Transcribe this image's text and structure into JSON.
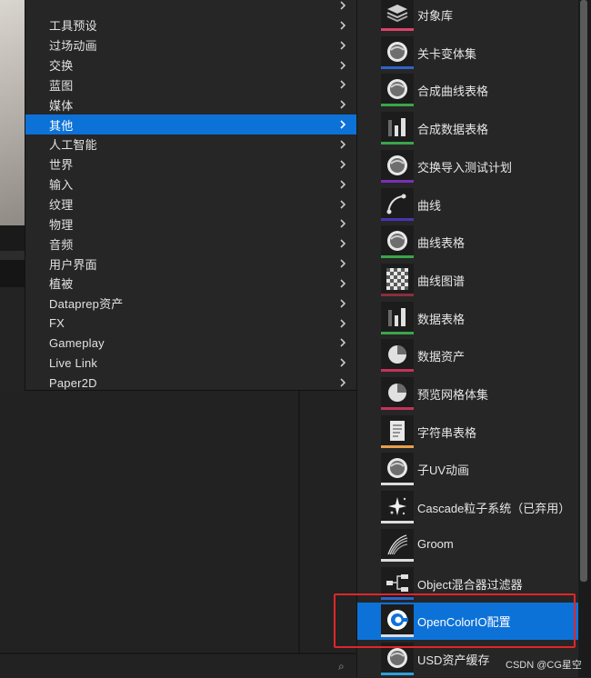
{
  "left_menu": {
    "items": [
      {
        "label": "",
        "icon": "chevron-right-icon"
      },
      {
        "label": "工具预设",
        "icon": "chevron-right-icon"
      },
      {
        "label": "过场动画",
        "icon": "chevron-right-icon"
      },
      {
        "label": "交换",
        "icon": "chevron-right-icon"
      },
      {
        "label": "蓝图",
        "icon": "chevron-right-icon"
      },
      {
        "label": "媒体",
        "icon": "chevron-right-icon"
      },
      {
        "label": "其他",
        "icon": "chevron-right-icon",
        "active": true
      },
      {
        "label": "人工智能",
        "icon": "chevron-right-icon"
      },
      {
        "label": "世界",
        "icon": "chevron-right-icon"
      },
      {
        "label": "输入",
        "icon": "chevron-right-icon"
      },
      {
        "label": "纹理",
        "icon": "chevron-right-icon"
      },
      {
        "label": "物理",
        "icon": "chevron-right-icon"
      },
      {
        "label": "音频",
        "icon": "chevron-right-icon"
      },
      {
        "label": "用户界面",
        "icon": "chevron-right-icon"
      },
      {
        "label": "植被",
        "icon": "chevron-right-icon"
      },
      {
        "label": "Dataprep资产",
        "icon": "chevron-right-icon"
      },
      {
        "label": "FX",
        "icon": "chevron-right-icon"
      },
      {
        "label": "Gameplay",
        "icon": "chevron-right-icon"
      },
      {
        "label": "Live Link",
        "icon": "chevron-right-icon"
      },
      {
        "label": "Paper2D",
        "icon": "chevron-right-icon"
      }
    ]
  },
  "submenu": {
    "items": [
      {
        "label": "对象库",
        "icon": "object-library-icon",
        "bar_color": "#d9426a"
      },
      {
        "label": "关卡变体集",
        "icon": "sphere-icon",
        "bar_color": "#2f64c8"
      },
      {
        "label": "合成曲线表格",
        "icon": "sphere-icon",
        "bar_color": "#3aa64a"
      },
      {
        "label": "合成数据表格",
        "icon": "bar-chart-icon",
        "bar_color": "#3aa64a"
      },
      {
        "label": "交换导入测试计划",
        "icon": "sphere-icon",
        "bar_color": "#7a2fb8"
      },
      {
        "label": "曲线",
        "icon": "curve-icon",
        "bar_color": "#4b34b0"
      },
      {
        "label": "曲线表格",
        "icon": "sphere-icon",
        "bar_color": "#3aa64a"
      },
      {
        "label": "曲线图谱",
        "icon": "checker-icon",
        "bar_color": "#8a2e3e"
      },
      {
        "label": "数据表格",
        "icon": "bar-chart-icon",
        "bar_color": "#3aa64a"
      },
      {
        "label": "数据资产",
        "icon": "pie-chart-icon",
        "bar_color": "#c2335a"
      },
      {
        "label": "预览网格体集",
        "icon": "pie-chart-icon",
        "bar_color": "#c2335a"
      },
      {
        "label": "字符串表格",
        "icon": "string-table-icon",
        "bar_color": "#e8a04a"
      },
      {
        "label": "子UV动画",
        "icon": "sphere-icon",
        "bar_color": "#dcdcdc"
      },
      {
        "label": "Cascade粒子系统（已弃用）",
        "icon": "sparkle-icon",
        "bar_color": "#dcdcdc"
      },
      {
        "label": "Groom",
        "icon": "groom-icon",
        "bar_color": "#dcdcdc"
      },
      {
        "label": "Object混合器过滤器",
        "icon": "node-graph-icon",
        "bar_color": "#2f64c8"
      },
      {
        "label": "OpenColorIO配置",
        "icon": "opencolorio-icon",
        "bar_color": "#dcdcdc",
        "active": true
      },
      {
        "label": "USD资产缓存",
        "icon": "sphere-icon",
        "bar_color": "#2f9fd8"
      }
    ]
  },
  "watermark": "CSDN @CG星空",
  "colors": {
    "selection": "#0d72d8",
    "highlight_box": "#e0262a"
  }
}
